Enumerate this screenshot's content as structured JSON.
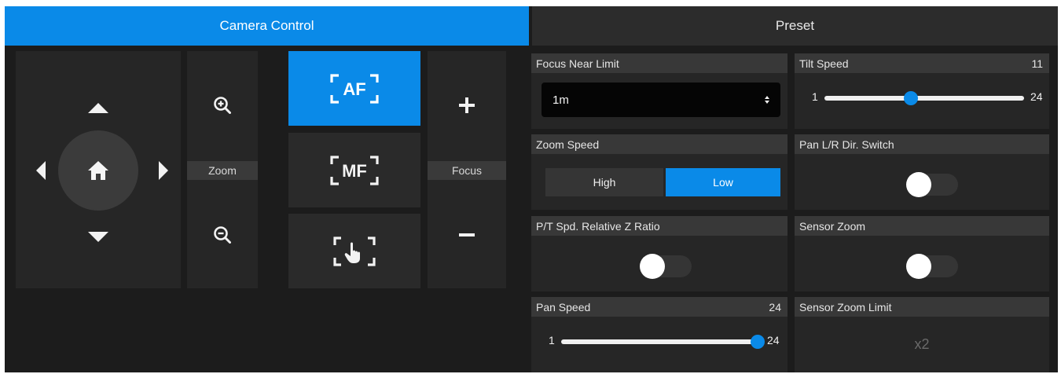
{
  "tabs": {
    "camera_control": "Camera Control",
    "preset": "Preset"
  },
  "ptz": {
    "zoom_label": "Zoom",
    "focus_label": "Focus",
    "focus_mode_active": "AF",
    "icons": [
      "up-arrow-icon",
      "down-arrow-icon",
      "left-arrow-icon",
      "right-arrow-icon",
      "home-icon",
      "zoom-in-icon",
      "zoom-out-icon",
      "plus-icon",
      "minus-icon",
      "touch-focus-icon"
    ]
  },
  "focus_mode": {
    "af": "AF",
    "mf": "MF"
  },
  "settings": {
    "focus_near_limit": {
      "label": "Focus Near Limit",
      "value": "1m"
    },
    "tilt_speed": {
      "label": "Tilt Speed",
      "value": 11,
      "min": 1,
      "max": 24
    },
    "zoom_speed": {
      "label": "Zoom Speed",
      "options": [
        "High",
        "Low"
      ],
      "selected": "Low"
    },
    "pan_lr_dir_switch": {
      "label": "Pan L/R Dir. Switch",
      "state": "off"
    },
    "pt_spd_relative_z_ratio": {
      "label": "P/T Spd. Relative Z Ratio",
      "state": "off"
    },
    "sensor_zoom": {
      "label": "Sensor Zoom",
      "state": "off"
    },
    "pan_speed": {
      "label": "Pan Speed",
      "value": 24,
      "min": 1,
      "max": 24
    },
    "sensor_zoom_limit": {
      "label": "Sensor Zoom Limit",
      "value": "x2"
    }
  },
  "colors": {
    "accent": "#0a8ae8",
    "panel_bg": "#1c1c1c",
    "tile_bg": "#262626",
    "header_bg": "#383838"
  }
}
